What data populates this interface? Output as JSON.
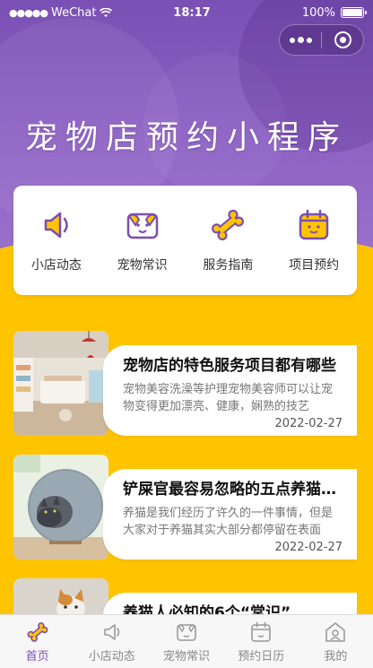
{
  "status_bar": {
    "carrier": "WeChat",
    "time": "18:17",
    "battery": "100%"
  },
  "hero": {
    "title": "宠物店预约小程序"
  },
  "features": [
    {
      "label": "小店动态",
      "icon": "speaker-icon"
    },
    {
      "label": "宠物常识",
      "icon": "pet-face-icon"
    },
    {
      "label": "服务指南",
      "icon": "bone-icon"
    },
    {
      "label": "项目预约",
      "icon": "calendar-icon"
    }
  ],
  "articles": [
    {
      "title": "宠物店的特色服务项目都有哪些",
      "desc": "宠物美容洗澡等护理宠物美容师可以让宠物变得更加漂亮、健康，娴熟的技艺",
      "date": "2022-02-27",
      "image": "pet-shop-interior-photo"
    },
    {
      "title": "铲屎官最容易忽略的五点养猫知识",
      "desc": "养猫是我们经历了许久的一件事情，但是大家对于养猫其实大部分都停留在表面",
      "date": "2022-02-27",
      "image": "cat-in-pod-bed-photo"
    },
    {
      "title": "养猫人必知的6个“常识”",
      "desc": "",
      "date": "",
      "image": "cat-photo"
    }
  ],
  "tabbar": [
    {
      "label": "首页",
      "icon": "bone-icon",
      "active": true
    },
    {
      "label": "小店动态",
      "icon": "speaker-icon",
      "active": false
    },
    {
      "label": "宠物常识",
      "icon": "pet-face-icon",
      "active": false
    },
    {
      "label": "预约日历",
      "icon": "calendar-icon",
      "active": false
    },
    {
      "label": "我的",
      "icon": "home-profile-icon",
      "active": false
    }
  ],
  "colors": {
    "primary": "#7a4fb6",
    "accent": "#ffc400",
    "hero_top": "#7a50b4"
  }
}
